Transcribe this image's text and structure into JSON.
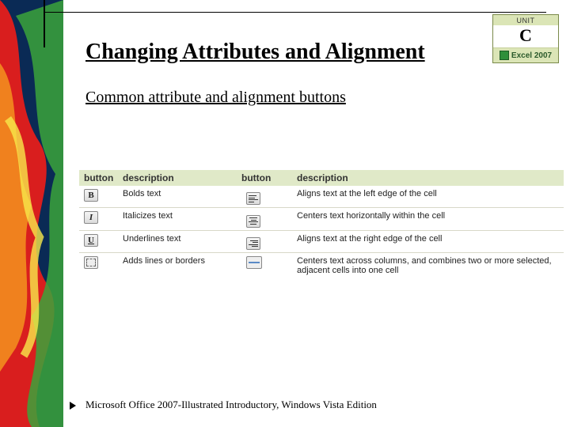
{
  "title": "Changing Attributes and Alignment",
  "subtitle": "Common attribute and alignment buttons",
  "headers": {
    "btn1": "button",
    "desc1": "description",
    "btn2": "button",
    "desc2": "description"
  },
  "rows": [
    {
      "icon1": "bold-icon",
      "glyph1": "B",
      "desc1": "Bolds text",
      "icon2": "align-left-icon",
      "desc2": "Aligns text at the left edge of the cell"
    },
    {
      "icon1": "italic-icon",
      "glyph1": "I",
      "desc1": "Italicizes text",
      "icon2": "align-center-icon",
      "desc2": "Centers text horizontally within the cell"
    },
    {
      "icon1": "underline-icon",
      "glyph1": "U",
      "desc1": "Underlines text",
      "icon2": "align-right-icon",
      "desc2": "Aligns text at the right edge of the cell"
    },
    {
      "icon1": "borders-icon",
      "glyph1": "",
      "desc1": "Adds lines or borders",
      "icon2": "merge-center-icon",
      "desc2": "Centers text across columns, and combines two or more selected, adjacent cells into one cell"
    }
  ],
  "badge": {
    "unit_label": "UNIT",
    "unit_letter": "C",
    "product": "Excel 2007"
  },
  "footer": "Microsoft Office 2007-Illustrated Introductory, Windows Vista Edition"
}
